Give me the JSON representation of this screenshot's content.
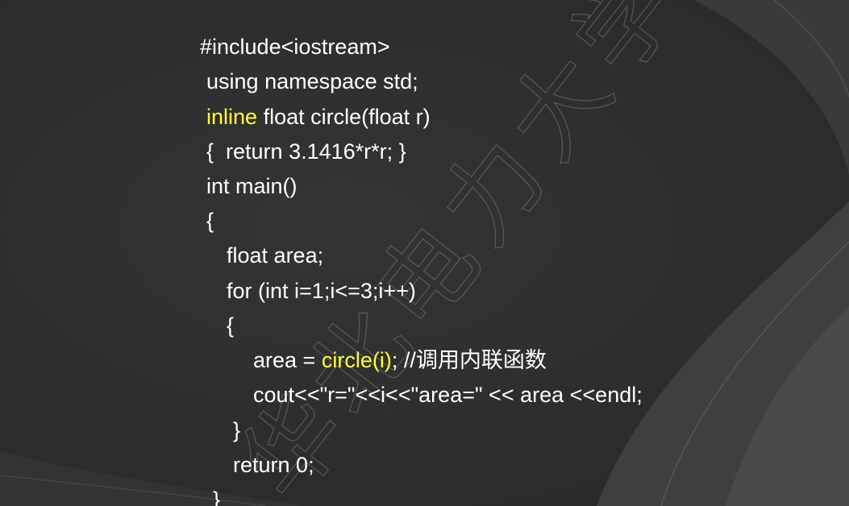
{
  "watermark": {
    "text": "华北电力大学"
  },
  "colors": {
    "background": "#2f2f2f",
    "text": "#ffffff",
    "highlight": "#ffff33"
  },
  "code": {
    "line1": "#include<iostream>",
    "line2": "using namespace std;",
    "line3_highlight": "inline",
    "line3_rest": " float circle(float r)",
    "line4": "{  return 3.1416*r*r; }",
    "line5": "int main()",
    "line6": "{",
    "line7": "float area;",
    "line8": "for (int i=1;i<=3;i++)",
    "line9": "{",
    "line10_pre": "area = ",
    "line10_highlight": "circle(i)",
    "line10_post": "; //调用内联函数",
    "line11": "cout<<\"r=\"<<i<<\"area=\" << area <<endl;",
    "line12": "}",
    "line13": "return 0;",
    "line14": "}"
  }
}
